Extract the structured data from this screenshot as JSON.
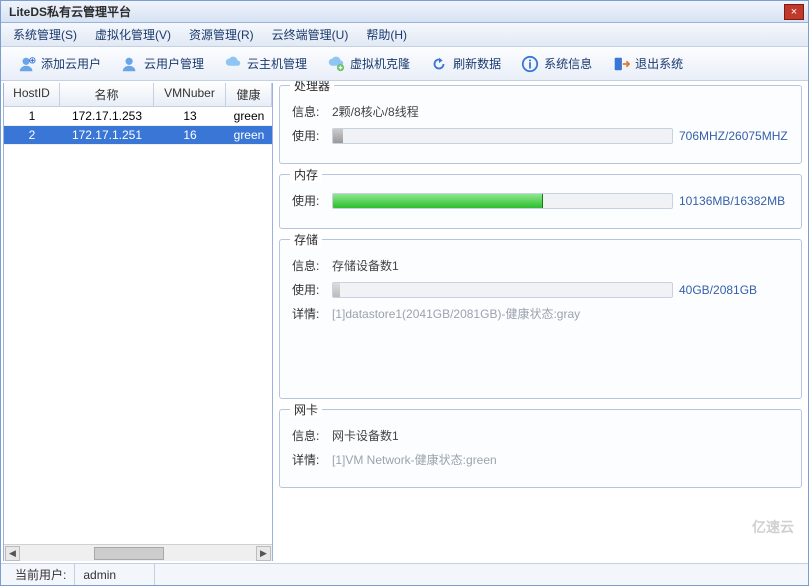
{
  "window": {
    "title": "LiteDS私有云管理平台"
  },
  "menu": {
    "system": "系统管理(S)",
    "virtualization": "虚拟化管理(V)",
    "resource": "资源管理(R)",
    "terminal": "云终端管理(U)",
    "help": "帮助(H)"
  },
  "toolbar": {
    "add_cloud_user": "添加云用户",
    "cloud_user_mgmt": "云用户管理",
    "cloud_host_mgmt": "云主机管理",
    "vm_clone": "虚拟机克隆",
    "refresh": "刷新数据",
    "sysinfo": "系统信息",
    "exit": "退出系统"
  },
  "grid": {
    "headers": {
      "hostid": "HostID",
      "name": "名称",
      "vmnum": "VMNuber",
      "health": "健康"
    },
    "rows": [
      {
        "hostid": "1",
        "name": "172.17.1.253",
        "vmnum": "13",
        "health": "green",
        "selected": false
      },
      {
        "hostid": "2",
        "name": "172.17.1.251",
        "vmnum": "16",
        "health": "green",
        "selected": true
      }
    ]
  },
  "panels": {
    "cpu": {
      "title": "处理器",
      "info_label": "信息:",
      "info_value": "2颗/8核心/8线程",
      "usage_label": "使用:",
      "usage_text": "706MHZ/26075MHZ",
      "usage_pct": 3
    },
    "mem": {
      "title": "内存",
      "usage_label": "使用:",
      "usage_text": "10136MB/16382MB",
      "usage_pct": 62
    },
    "storage": {
      "title": "存储",
      "info_label": "信息:",
      "info_value": "存储设备数1",
      "usage_label": "使用:",
      "usage_text": "40GB/2081GB",
      "usage_pct": 2,
      "detail_label": "详情:",
      "detail_value": "[1]datastore1(2041GB/2081GB)-健康状态:gray"
    },
    "nic": {
      "title": "网卡",
      "info_label": "信息:",
      "info_value": "网卡设备数1",
      "detail_label": "详情:",
      "detail_value": "[1]VM Network-健康状态:green"
    }
  },
  "status": {
    "current_user_label": "当前用户:",
    "current_user": "admin"
  },
  "watermark": "亿速云"
}
